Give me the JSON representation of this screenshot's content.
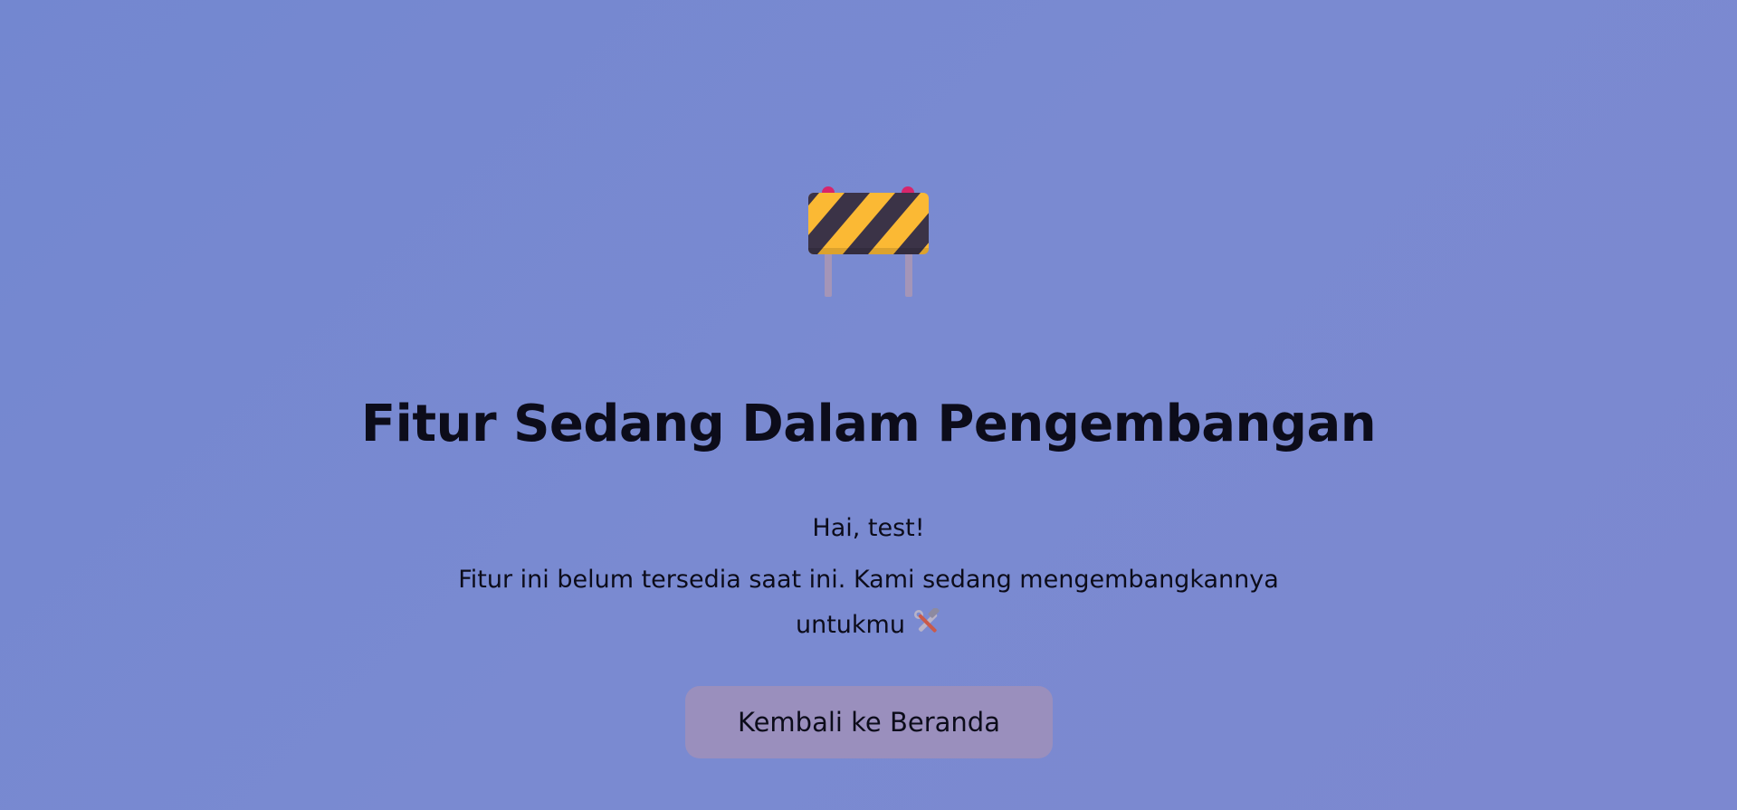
{
  "hero": {
    "icon": "construction-barrier-icon",
    "title": "Fitur Sedang Dalam Pengembangan"
  },
  "message": {
    "greeting": "Hai, test!",
    "body": "Fitur ini belum tersedia saat ini. Kami sedang mengembangkannya untukmu",
    "trailing_icon": "hammer-and-wrench-icon"
  },
  "actions": {
    "home_button_label": "Kembali ke Beranda"
  },
  "colors": {
    "background": "#7a8ad1",
    "button_background": "#9a8fbd",
    "text": "#0c0c1a",
    "barrier_yellow": "#fbb934",
    "barrier_dark": "#3b3347"
  }
}
